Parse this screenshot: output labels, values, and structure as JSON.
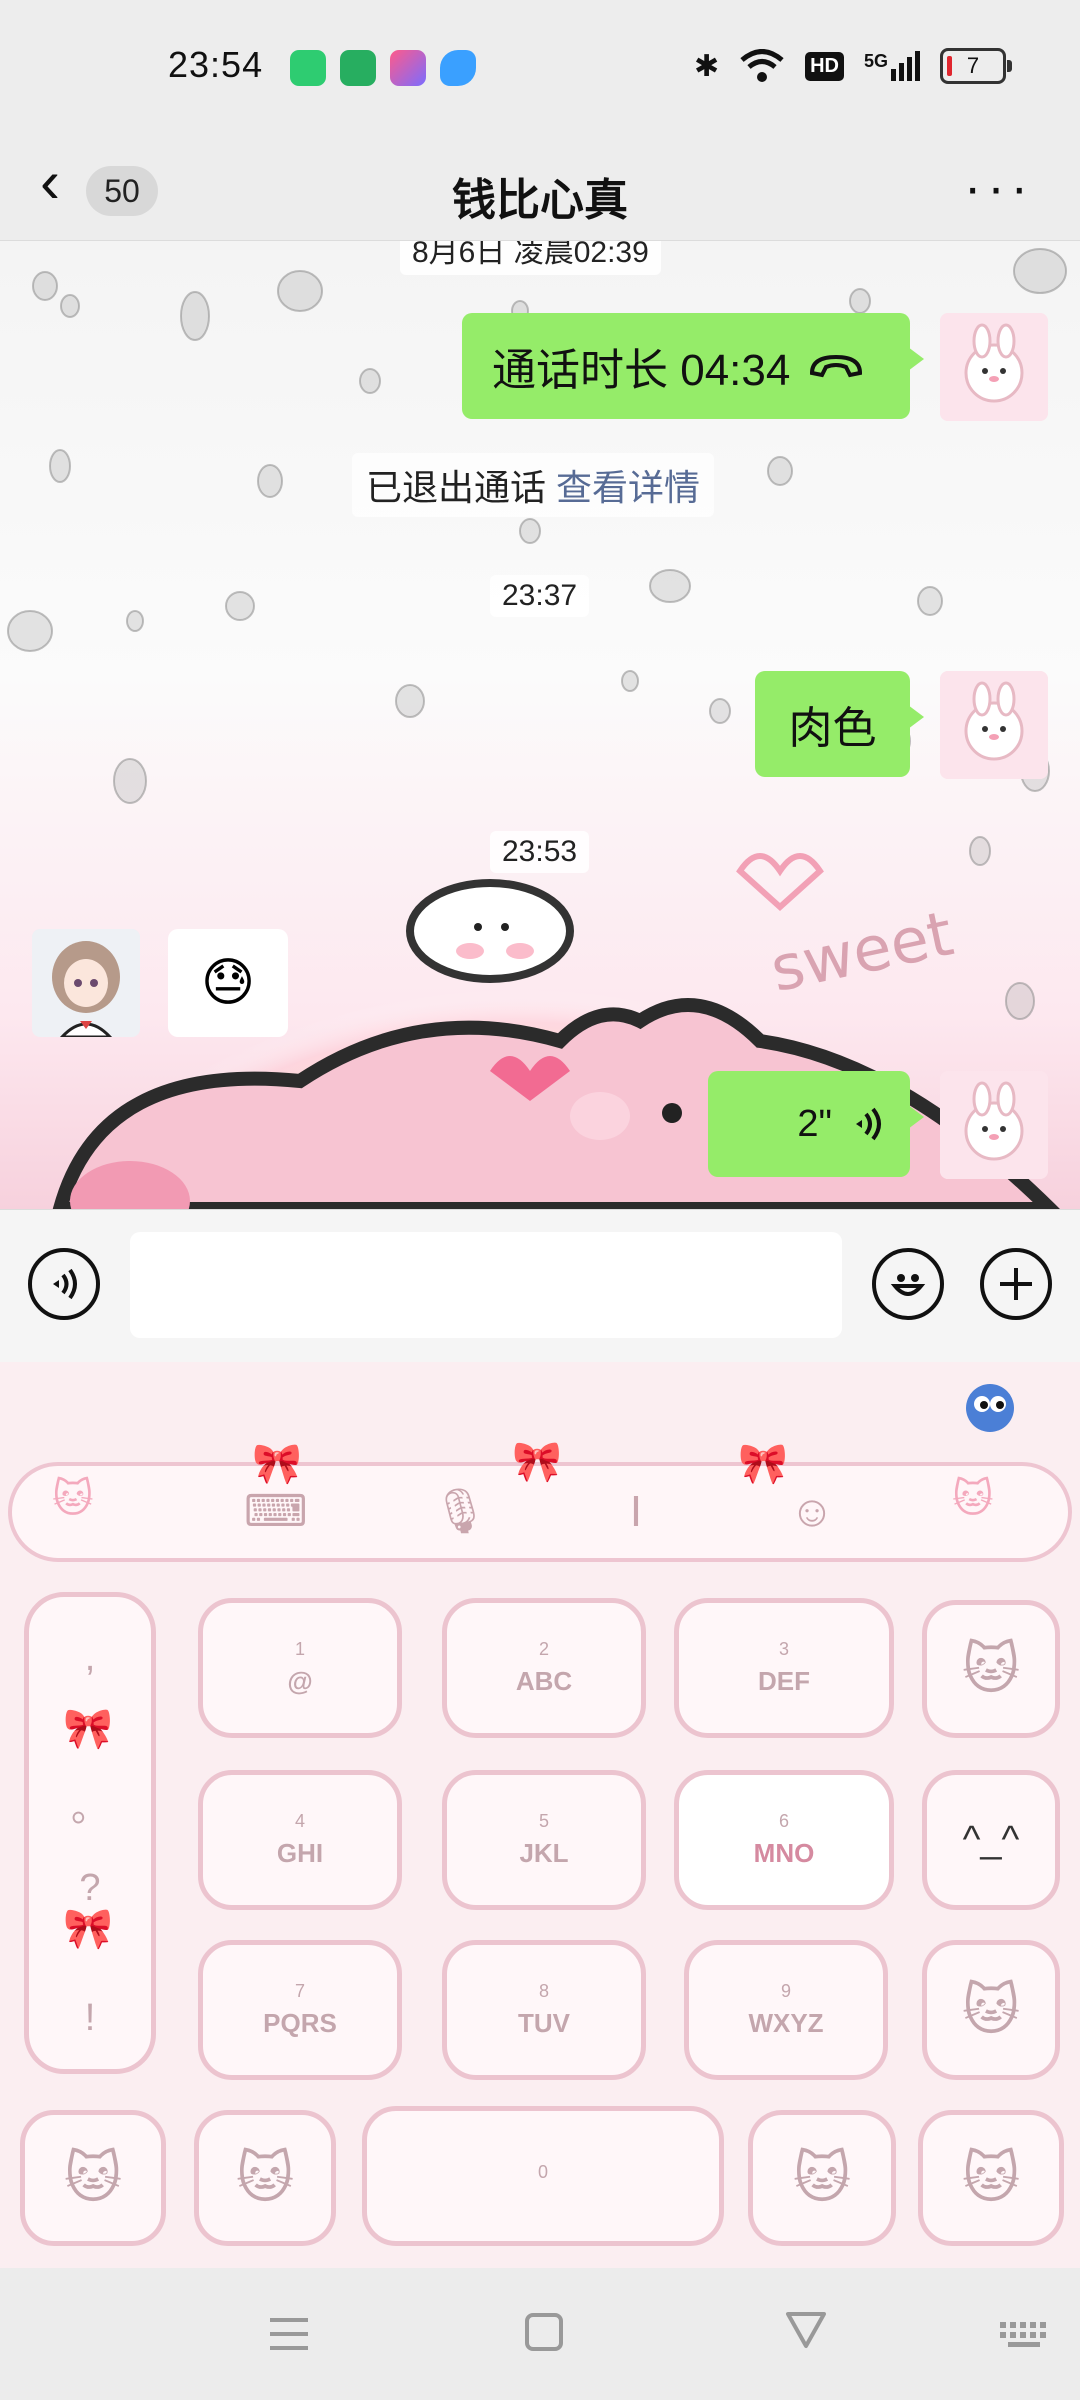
{
  "status_bar": {
    "time": "23:54",
    "network_badge": "HD",
    "signal_label": "5G",
    "battery_level": "7",
    "app_icon_colors": [
      "#2ecc71",
      "#27ae60",
      "#e056a0",
      "#3498db"
    ]
  },
  "header": {
    "unread_count": "50",
    "title": "钱比心真",
    "more_label": "···"
  },
  "chat": {
    "messages": [
      {
        "type": "timestamp",
        "text": "8月6日 凌晨02:39"
      },
      {
        "type": "sent_call",
        "text": "通话时长 04:34",
        "icon": "phone-hangup-icon"
      },
      {
        "type": "system",
        "text": "已退出通话 ",
        "link": "查看详情"
      },
      {
        "type": "timestamp",
        "text": "23:37"
      },
      {
        "type": "sent_text",
        "text": "肉色"
      },
      {
        "type": "timestamp",
        "text": "23:53"
      },
      {
        "type": "received_emoji",
        "emoji": "😓"
      },
      {
        "type": "sent_voice",
        "duration": "2\"",
        "icon": "voice-wave-icon"
      }
    ]
  },
  "keyboard": {
    "keys": [
      {
        "num": "1",
        "label": "@"
      },
      {
        "num": "2",
        "label": "ABC"
      },
      {
        "num": "3",
        "label": "DEF"
      },
      {
        "num": "4",
        "label": "GHI"
      },
      {
        "num": "5",
        "label": "JKL"
      },
      {
        "num": "6",
        "label": "MNO"
      },
      {
        "num": "7",
        "label": "PQRS"
      },
      {
        "num": "8",
        "label": "TUV"
      },
      {
        "num": "9",
        "label": "WXYZ"
      },
      {
        "num": "0",
        "label": ""
      }
    ],
    "punctuation": [
      ",",
      "。",
      "?",
      "!"
    ],
    "emoticon": "^_^",
    "theme_color": "#ecc4cf"
  }
}
